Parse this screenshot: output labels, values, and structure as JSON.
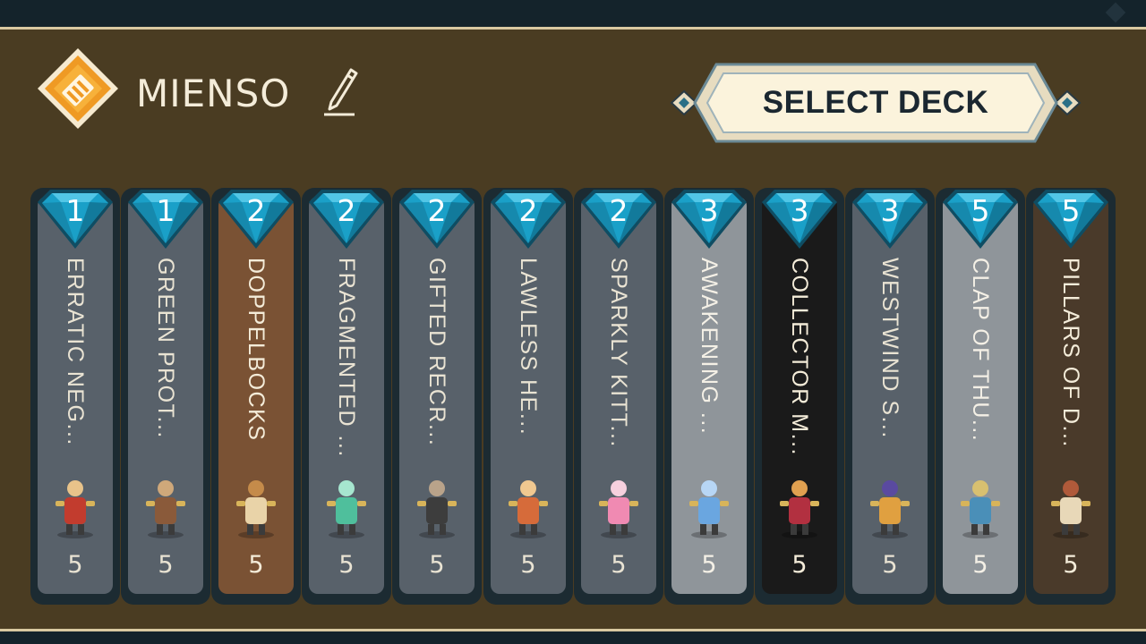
{
  "header": {
    "title": "MIENSO",
    "select_deck_label": "SELECT DECK"
  },
  "colors": {
    "panel": "#4a3c22",
    "panel_border": "#d9c9a1",
    "outer": "#14232b",
    "gem": "#1aa0c8",
    "logo_orange": "#ef9a24",
    "button_fill": "#fbf3dc"
  },
  "cards": [
    {
      "cost": "1",
      "name": "ERRATIC NEG...",
      "count": "5",
      "bg": "#58616a",
      "fg": "#e9e3d3",
      "icon": "red-robed-mage-icon"
    },
    {
      "cost": "1",
      "name": "GREEN PROT...",
      "count": "5",
      "bg": "#58616a",
      "fg": "#e9e3d3",
      "icon": "armored-robot-icon"
    },
    {
      "cost": "2",
      "name": "DOPPELBOCKS",
      "count": "5",
      "bg": "#7a5234",
      "fg": "#f4ecd9",
      "icon": "goat-warrior-icon"
    },
    {
      "cost": "2",
      "name": "FRAGMENTED ...",
      "count": "5",
      "bg": "#58616a",
      "fg": "#e9e3d3",
      "icon": "crystal-spirit-icon"
    },
    {
      "cost": "2",
      "name": "GIFTED RECR...",
      "count": "5",
      "bg": "#58616a",
      "fg": "#e9e3d3",
      "icon": "dual-blade-fighter-icon"
    },
    {
      "cost": "2",
      "name": "LAWLESS HE...",
      "count": "5",
      "bg": "#58616a",
      "fg": "#e9e3d3",
      "icon": "tribal-chief-icon"
    },
    {
      "cost": "2",
      "name": "SPARKLY KITT...",
      "count": "5",
      "bg": "#58616a",
      "fg": "#e9e3d3",
      "icon": "pink-kitten-icon"
    },
    {
      "cost": "3",
      "name": "AWAKENING ...",
      "count": "5",
      "bg": "#8f959a",
      "fg": "#f4f0e6",
      "icon": "glowing-figure-icon"
    },
    {
      "cost": "3",
      "name": "COLLECTOR M...",
      "count": "5",
      "bg": "#1a1a1a",
      "fg": "#f4ecd9",
      "icon": "throne-collector-icon"
    },
    {
      "cost": "3",
      "name": "WESTWIND S...",
      "count": "5",
      "bg": "#58616a",
      "fg": "#e9e3d3",
      "icon": "swordsman-icon"
    },
    {
      "cost": "5",
      "name": "CLAP OF THU...",
      "count": "5",
      "bg": "#8f959a",
      "fg": "#f4f0e6",
      "icon": "thunder-bolt-icon"
    },
    {
      "cost": "5",
      "name": "PILLARS OF D...",
      "count": "5",
      "bg": "#4a3a2a",
      "fg": "#f4ecd9",
      "icon": "pillar-shrine-icon"
    }
  ]
}
